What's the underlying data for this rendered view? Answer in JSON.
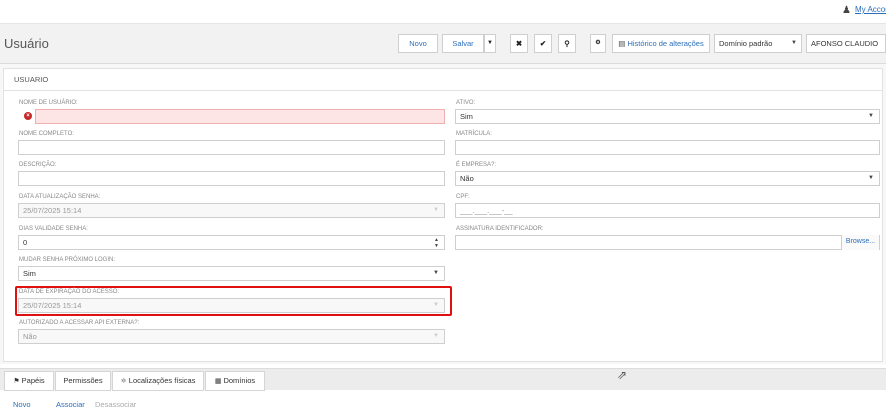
{
  "top": {
    "account_link": "My Account"
  },
  "header": {
    "title": "Usuário",
    "novo": "Novo",
    "salvar": "Salvar",
    "historico": "Histórico de alterações",
    "dominio": "Domínio padrão",
    "org": "AFONSO CLAUDIO"
  },
  "form": {
    "section": "USUARIO",
    "nome_usuario": {
      "label": "NOME DE USUÁRIO:",
      "value": ""
    },
    "nome_completo": {
      "label": "NOME COMPLETO:",
      "value": ""
    },
    "descricao": {
      "label": "DESCRIÇÃO:",
      "value": ""
    },
    "data_atualizacao": {
      "label": "DATA ATUALIZAÇÃO SENHA:",
      "value": "25/07/2025 15:14"
    },
    "dias_validade": {
      "label": "DIAS VALIDADE SENHA:",
      "value": "0"
    },
    "mudar_senha": {
      "label": "MUDAR SENHA PRÓXIMO LOGIN:",
      "value": "Sim"
    },
    "data_expiracao": {
      "label": "DATA DE EXPIRAÇÃO DO ACESSO:",
      "value": "25/07/2025 15:14"
    },
    "autorizado_api": {
      "label": "AUTORIZADO A ACESSAR API EXTERNA?:",
      "value": "Não"
    },
    "ativo": {
      "label": "ATIVO:",
      "value": "Sim"
    },
    "matricula": {
      "label": "MATRÍCULA:",
      "value": ""
    },
    "empresa": {
      "label": "É EMPRESA?:",
      "value": "Não"
    },
    "cpf": {
      "label": "CPF:",
      "value": "___.___.___-__"
    },
    "assinatura": {
      "label": "ASSINATURA IDENTIFICADOR:",
      "browse": "Browse..."
    }
  },
  "tabs": [
    "Papéis",
    "Permissões",
    "Localizações físicas",
    "Domínios"
  ],
  "actions": {
    "novo": "Novo",
    "associar": "Associar",
    "desassociar": "Desassociar"
  }
}
